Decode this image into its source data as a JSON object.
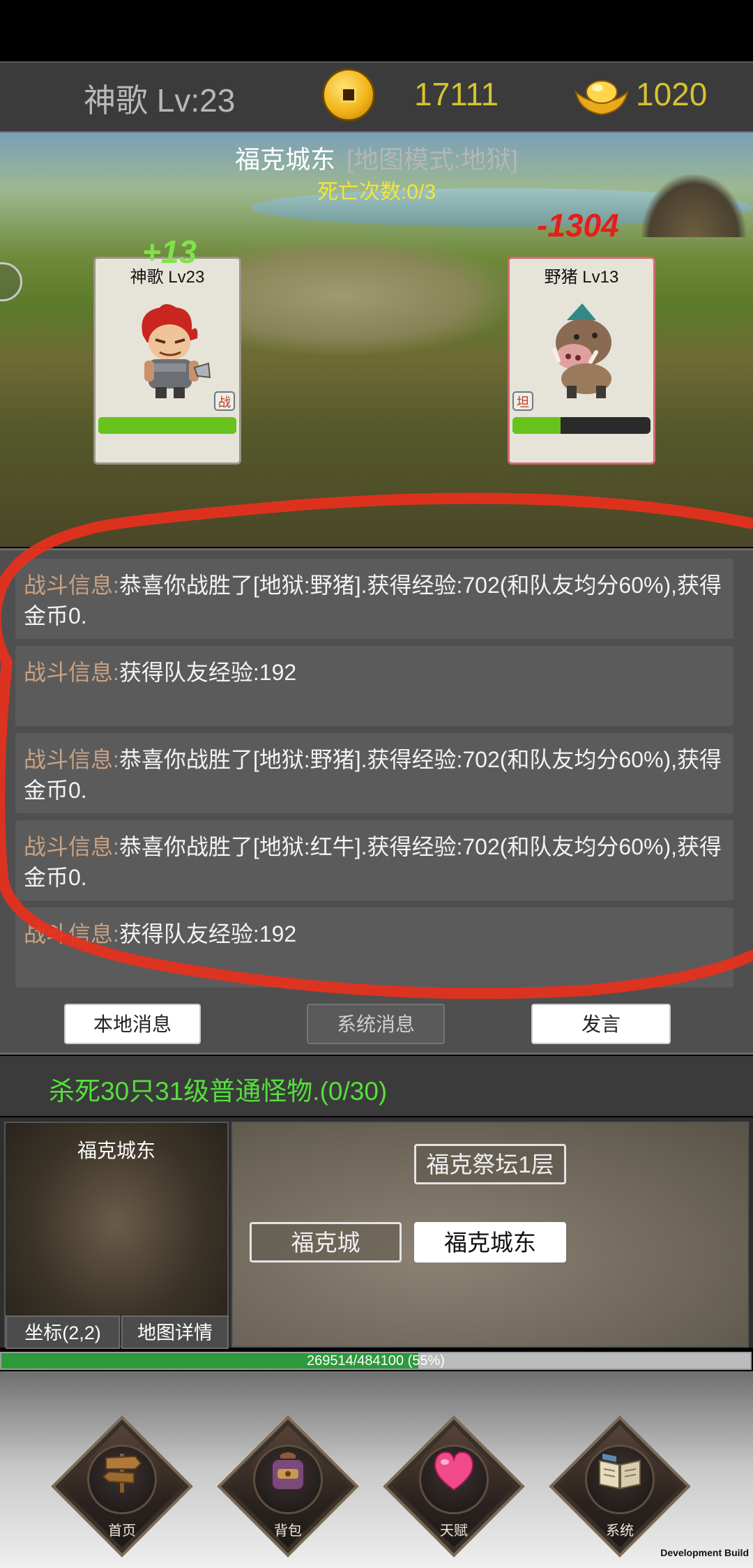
{
  "header": {
    "player_name": "神歌 Lv:23",
    "gold": "17111",
    "ingots": "1020"
  },
  "battle": {
    "map_name": "福克城东",
    "map_mode": "[地图模式:地狱]",
    "death_count": "死亡次数:0/3",
    "player": {
      "label": "神歌 Lv23",
      "role": "战",
      "hp_fraction": 1.0,
      "float_text": "+13"
    },
    "enemy": {
      "label": "野猪 Lv13",
      "role": "坦",
      "hp_fraction": 0.35,
      "float_text": "-1304"
    }
  },
  "chat": {
    "messages": [
      {
        "prefix": "战斗信息:",
        "text": "恭喜你战胜了[地狱:野猪].获得经验:702(和队友均分60%),获得金币0."
      },
      {
        "prefix": "战斗信息:",
        "text": "获得队友经验:192"
      },
      {
        "prefix": "战斗信息:",
        "text": "恭喜你战胜了[地狱:野猪].获得经验:702(和队友均分60%),获得金币0."
      },
      {
        "prefix": "战斗信息:",
        "text": "恭喜你战胜了[地狱:红牛].获得经验:702(和队友均分60%),获得金币0."
      },
      {
        "prefix": "战斗信息:",
        "text": "获得队友经验:192"
      }
    ],
    "tabs": {
      "local": "本地消息",
      "system": "系统消息",
      "speak": "发言"
    }
  },
  "quest": {
    "text": "杀死30只31级普通怪物.(0/30)"
  },
  "minimap": {
    "title": "福克城东",
    "coord_button": "坐标(2,2)",
    "detail_button": "地图详情"
  },
  "world_map": {
    "altar": "福克祭坛1层",
    "fuke_city": "福克城",
    "fuke_east": "福克城东"
  },
  "xp": {
    "text": "269514/484100 (55%)",
    "fraction": 0.557
  },
  "nav": {
    "home": "首页",
    "bag": "背包",
    "talent": "天赋",
    "system": "系统"
  },
  "footer": {
    "dev_build": "Development Build"
  },
  "colors": {
    "accent_gold": "#d5c332",
    "quest_green": "#54e03a",
    "message_prefix": "#caa283",
    "damage_red": "#e81c1c",
    "annotation_red": "#e8301c"
  }
}
